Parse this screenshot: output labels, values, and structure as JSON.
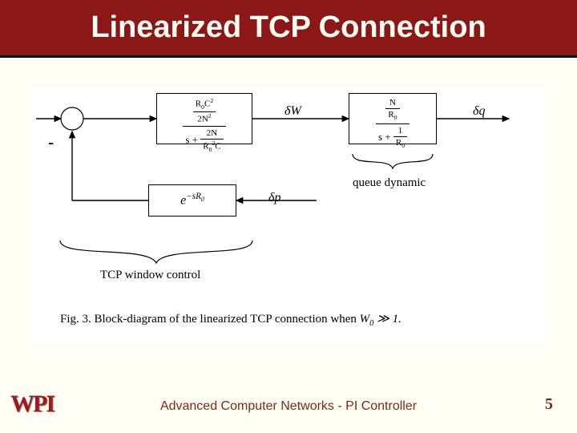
{
  "title": "Linearized TCP Connection",
  "diagram": {
    "summing_minus": "-",
    "block1": {
      "num_html": "R<sub>0</sub>C<sup>2</sup>",
      "num_den_html": "2N<sup>2</sup>",
      "den_left": "s + ",
      "den_num_html": "2N",
      "den_den_html": "R<sub>0</sub><sup>2</sup>C"
    },
    "block2": {
      "num_html": "N",
      "num_den_html": "R<sub>0</sub>",
      "den_left": "s + ",
      "den_num_html": "1",
      "den_den_html": "R<sub>0</sub>"
    },
    "block3": {
      "expr_html": "e<sup>−sR<sub>0</sub></sup>"
    },
    "labels": {
      "dW": "δW",
      "dq": "δq",
      "dp": "δp",
      "queue_dynamic": "queue dynamic",
      "tcp_window_control": "TCP window control"
    },
    "caption_prefix": "Fig. 3.   Block-diagram of the linearized TCP connection when ",
    "caption_cond_html": "W<sub>0</sub> ≫ 1."
  },
  "footer": {
    "logo": "WPI",
    "text": "Advanced Computer Networks -  PI Controller",
    "page": "5"
  }
}
